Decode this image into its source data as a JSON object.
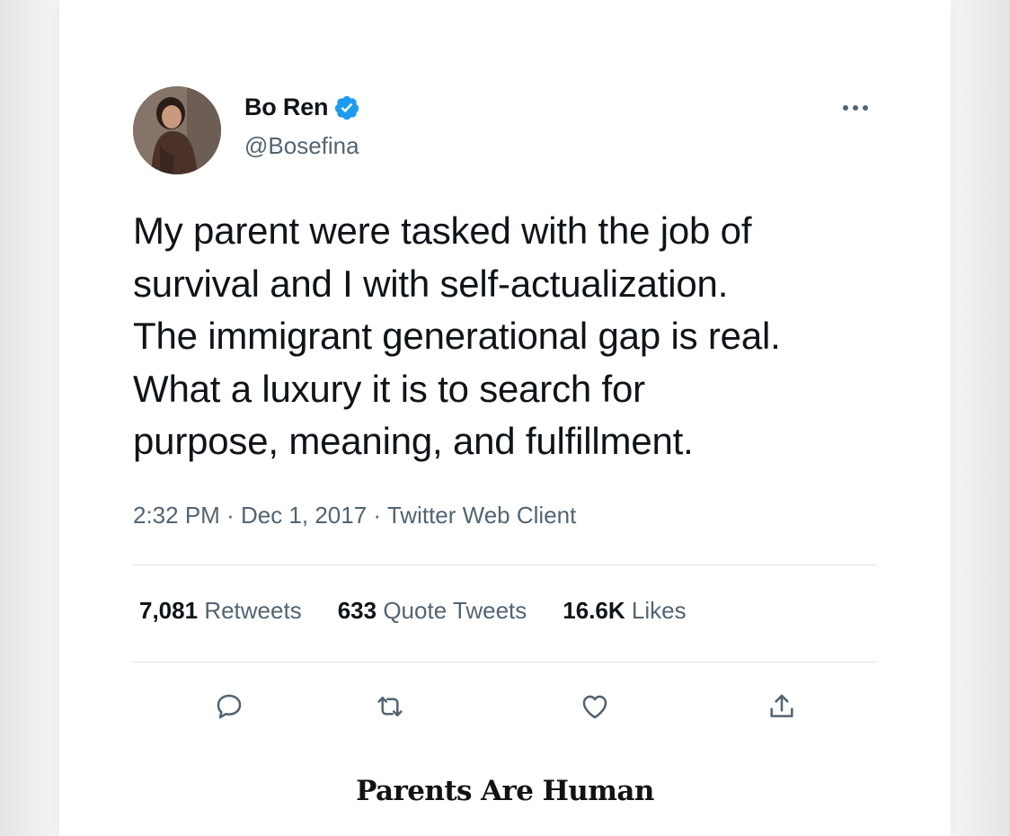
{
  "tweet": {
    "author": {
      "name": "Bo Ren",
      "handle": "@Bosefina",
      "verified": true,
      "avatar_icon": "profile-photo"
    },
    "text": "My parent were tasked with the job of\nsurvival and I with self-actualization.\nThe immigrant generational gap is real.\nWhat a luxury it is to search for\npurpose, meaning, and fulfillment.",
    "meta": {
      "time": "2:32 PM",
      "separator": "·",
      "date": "Dec 1, 2017",
      "client": "Twitter Web Client"
    },
    "stats": {
      "retweets_count": "7,081",
      "retweets_label": "Retweets",
      "quote_count": "633",
      "quote_label": "Quote Tweets",
      "likes_count": "16.6K",
      "likes_label": "Likes"
    },
    "actions": [
      "reply-icon",
      "retweet-icon",
      "like-icon",
      "share-icon"
    ]
  },
  "footer": {
    "title": "Parents Are Human"
  },
  "colors": {
    "verified_blue": "#1d9bf0",
    "text_primary": "#0f1419",
    "text_secondary": "#536471",
    "divider": "#e2e6e9"
  }
}
